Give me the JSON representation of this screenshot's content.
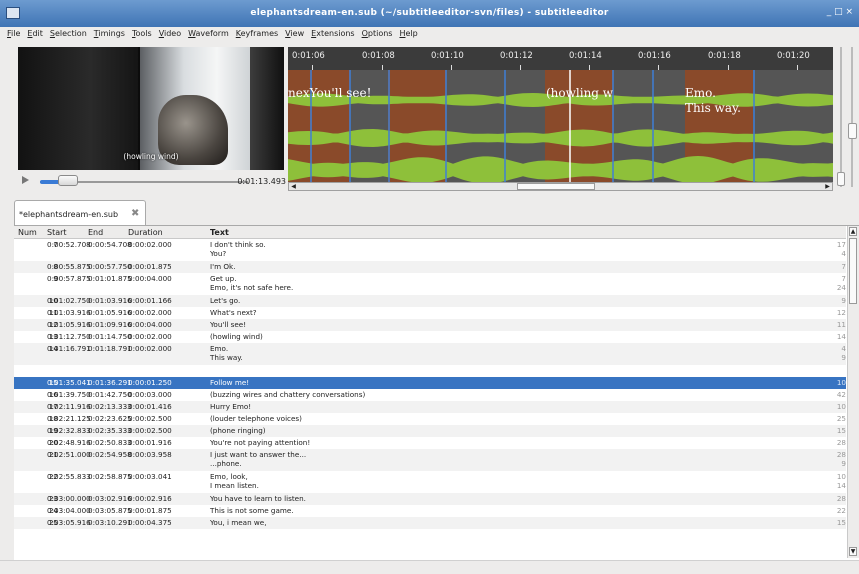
{
  "window": {
    "title": "elephantsdream-en.sub (~/subtitleeditor-svn/files) - subtitleeditor",
    "controls": "_ □ ×"
  },
  "menu": [
    "File",
    "Edit",
    "Selection",
    "Timings",
    "Tools",
    "Video",
    "Waveform",
    "Keyframes",
    "View",
    "Extensions",
    "Options",
    "Help"
  ],
  "video": {
    "subtitle": "(howling wind)",
    "time": "0:01:13.493",
    "progress": 0.064
  },
  "waveform": {
    "ruler": [
      "0:01:06",
      "0:01:08",
      "0:01:10",
      "0:01:12",
      "0:01:14",
      "0:01:16",
      "0:01:18",
      "0:01:20"
    ],
    "labels": [
      "nexYou'll see!",
      "(howling w",
      "Emo.",
      "This way."
    ],
    "colors": {
      "background": "#555555",
      "subtitle": "#8a4a2a",
      "wave": "#8ec03a",
      "marker": "#3f7fd6",
      "cursor": "#ffffff"
    }
  },
  "document": {
    "tab_label": "*elephantsdream-en.sub"
  },
  "table": {
    "headers": {
      "num": "Num",
      "start": "Start",
      "end": "End",
      "duration": "Duration",
      "text": "Text"
    },
    "rows": [
      {
        "num": "7",
        "start": "0:00:52.708",
        "end": "0:00:54.708",
        "duration": "0:00:02.000",
        "lines": [
          "I don't think so.",
          "You?"
        ],
        "cps": [
          "17",
          "4"
        ]
      },
      {
        "num": "8",
        "start": "0:00:55.875",
        "end": "0:00:57.750",
        "duration": "0:00:01.875",
        "lines": [
          "I'm Ok."
        ],
        "cps": [
          "7"
        ]
      },
      {
        "num": "9",
        "start": "0:00:57.875",
        "end": "0:01:01.875",
        "duration": "0:00:04.000",
        "lines": [
          "Get up.",
          "Emo, it's not safe here."
        ],
        "cps": [
          "7",
          "24"
        ]
      },
      {
        "num": "10",
        "start": "0:01:02.750",
        "end": "0:01:03.916",
        "duration": "0:00:01.166",
        "lines": [
          "Let's go."
        ],
        "cps": [
          "9"
        ]
      },
      {
        "num": "11",
        "start": "0:01:03.916",
        "end": "0:01:05.916",
        "duration": "0:00:02.000",
        "lines": [
          "What's next?"
        ],
        "cps": [
          "12"
        ]
      },
      {
        "num": "12",
        "start": "0:01:05.916",
        "end": "0:01:09.916",
        "duration": "0:00:04.000",
        "lines": [
          "You'll see!"
        ],
        "cps": [
          "11"
        ]
      },
      {
        "num": "13",
        "start": "0:01:12.750",
        "end": "0:01:14.750",
        "duration": "0:00:02.000",
        "lines": [
          "(howling wind)"
        ],
        "cps": [
          "14"
        ]
      },
      {
        "num": "14",
        "start": "0:01:16.791",
        "end": "0:01:18.791",
        "duration": "0:00:02.000",
        "lines": [
          "Emo.",
          "This way."
        ],
        "cps": [
          "4",
          "9"
        ]
      },
      {
        "num": "",
        "start": "",
        "end": "",
        "duration": "",
        "lines": [
          ""
        ],
        "cps": [
          ""
        ]
      },
      {
        "num": "15",
        "start": "0:01:35.041",
        "end": "0:01:36.291",
        "duration": "0:00:01.250",
        "lines": [
          "Follow me!"
        ],
        "cps": [
          "10"
        ],
        "selected": true
      },
      {
        "num": "16",
        "start": "0:01:39.750",
        "end": "0:01:42.750",
        "duration": "0:00:03.000",
        "lines": [
          "(buzzing wires and chattery conversations)"
        ],
        "cps": [
          "42"
        ]
      },
      {
        "num": "17",
        "start": "0:02:11.916",
        "end": "0:02:13.333",
        "duration": "0:00:01.416",
        "lines": [
          "Hurry Emo!"
        ],
        "cps": [
          "10"
        ]
      },
      {
        "num": "18",
        "start": "0:02:21.125",
        "end": "0:02:23.625",
        "duration": "0:00:02.500",
        "lines": [
          "(louder telephone voices)"
        ],
        "cps": [
          "25"
        ]
      },
      {
        "num": "19",
        "start": "0:02:32.833",
        "end": "0:02:35.333",
        "duration": "0:00:02.500",
        "lines": [
          "(phone ringing)"
        ],
        "cps": [
          "15"
        ]
      },
      {
        "num": "20",
        "start": "0:02:48.916",
        "end": "0:02:50.833",
        "duration": "0:00:01.916",
        "lines": [
          "You're not paying attention!"
        ],
        "cps": [
          "28"
        ]
      },
      {
        "num": "21",
        "start": "0:02:51.000",
        "end": "0:02:54.958",
        "duration": "0:00:03.958",
        "lines": [
          "I just want to answer the...",
          "...phone."
        ],
        "cps": [
          "28",
          "9"
        ]
      },
      {
        "num": "22",
        "start": "0:02:55.833",
        "end": "0:02:58.875",
        "duration": "0:00:03.041",
        "lines": [
          "Emo, look,",
          "I mean listen."
        ],
        "cps": [
          "10",
          "14"
        ]
      },
      {
        "num": "23",
        "start": "0:03:00.000",
        "end": "0:03:02.916",
        "duration": "0:00:02.916",
        "lines": [
          "You have to learn to listen."
        ],
        "cps": [
          "28"
        ]
      },
      {
        "num": "24",
        "start": "0:03:04.000",
        "end": "0:03:05.875",
        "duration": "0:00:01.875",
        "lines": [
          "This is not some game."
        ],
        "cps": [
          "22"
        ]
      },
      {
        "num": "25",
        "start": "0:03:05.916",
        "end": "0:03:10.291",
        "duration": "0:00:04.375",
        "lines": [
          "You, i mean we,"
        ],
        "cps": [
          "15"
        ]
      }
    ]
  }
}
